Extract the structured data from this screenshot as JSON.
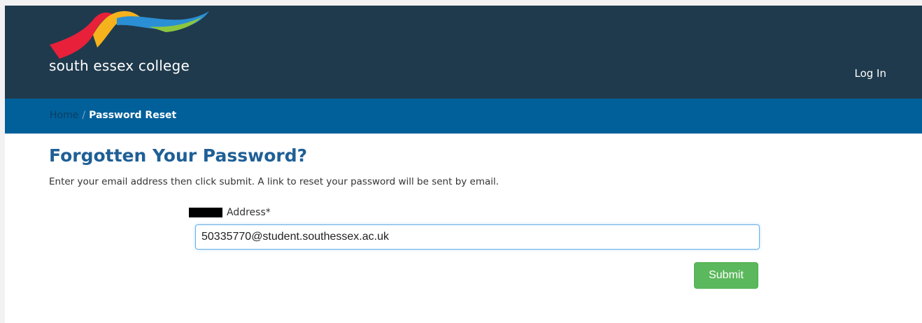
{
  "header": {
    "logo_text": "south essex college",
    "login_label": "Log In",
    "logo_colors": [
      "#e8203a",
      "#f5b21c",
      "#2a8fd4",
      "#8cc63f"
    ]
  },
  "breadcrumb": {
    "home_label": "Home",
    "separator": "/",
    "current_label": "Password Reset"
  },
  "main": {
    "title": "Forgotten Your Password?",
    "instructions": "Enter your email address then click submit. A link to reset your password will be sent by email.",
    "field_label": "Address*",
    "email_value": "50335770@student.southessex.ac.uk",
    "submit_label": "Submit"
  },
  "colors": {
    "header_bg": "#1f3a4d",
    "breadcrumb_bg": "#01609a",
    "title": "#1f5f96",
    "submit_bg": "#5cb85c"
  }
}
